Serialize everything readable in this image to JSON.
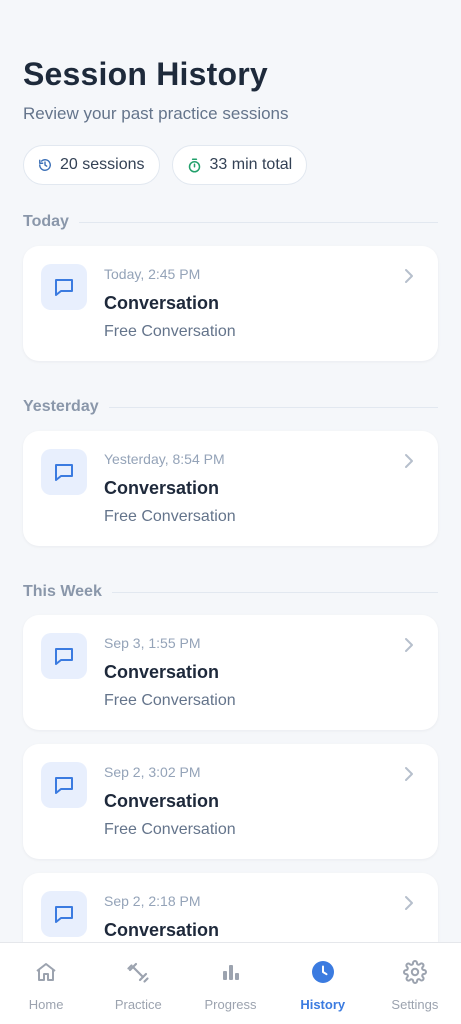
{
  "header": {
    "title": "Session History",
    "subtitle": "Review your past practice sessions"
  },
  "stats": {
    "sessions": "20 sessions",
    "total": "33 min total",
    "sessions_icon": "history-icon",
    "total_icon": "timer-icon"
  },
  "sections": [
    {
      "label": "Today"
    },
    {
      "label": "Yesterday"
    },
    {
      "label": "This Week"
    }
  ],
  "sessions": [
    {
      "time": "Today, 2:45 PM",
      "title": "Conversation",
      "type": "Free Conversation"
    },
    {
      "time": "Yesterday, 8:54 PM",
      "title": "Conversation",
      "type": "Free Conversation"
    },
    {
      "time": "Sep 3, 1:55 PM",
      "title": "Conversation",
      "type": "Free Conversation"
    },
    {
      "time": "Sep 2, 3:02 PM",
      "title": "Conversation",
      "type": "Free Conversation"
    },
    {
      "time": "Sep 2, 2:18 PM",
      "title": "Conversation",
      "type": ""
    }
  ],
  "tabs": [
    {
      "label": "Home",
      "icon": "home-icon"
    },
    {
      "label": "Practice",
      "icon": "dumbbell-icon"
    },
    {
      "label": "Progress",
      "icon": "bar-chart-icon"
    },
    {
      "label": "History",
      "icon": "clock-icon",
      "active": true
    },
    {
      "label": "Settings",
      "icon": "gear-icon"
    }
  ],
  "colors": {
    "accent": "#3b7be0",
    "background": "#f5f7fa",
    "timer_green": "#22a06b",
    "muted": "#9ca3af"
  }
}
